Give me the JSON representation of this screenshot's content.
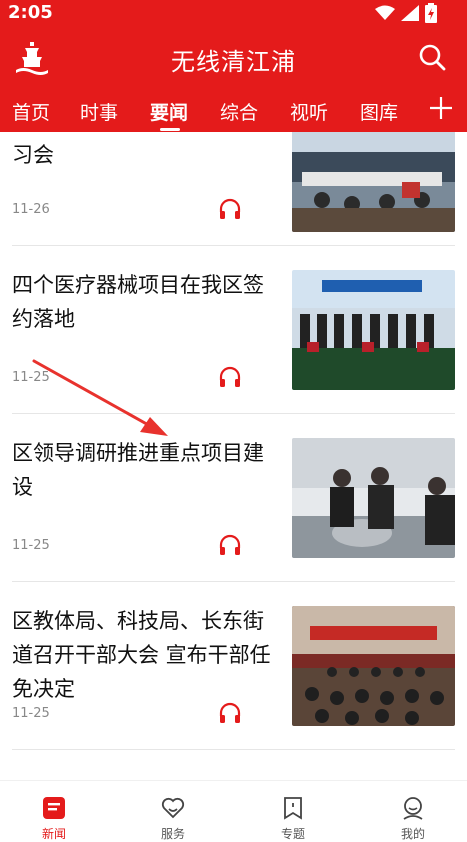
{
  "status_bar": {
    "time": "2:05"
  },
  "app": {
    "title": "无线清江浦"
  },
  "tabs": [
    {
      "label": "首页"
    },
    {
      "label": "时事"
    },
    {
      "label": "要闻"
    },
    {
      "label": "综合"
    },
    {
      "label": "视听"
    },
    {
      "label": "图库"
    }
  ],
  "active_tab": "要闻",
  "articles": [
    {
      "title": "习会",
      "date": "11-26"
    },
    {
      "title": "四个医疗器械项目在我区签约落地",
      "date": "11-25"
    },
    {
      "title": "区领导调研推进重点项目建设",
      "date": "11-25"
    },
    {
      "title": "区教体局、科技局、长东街道召开干部大会 宣布干部任免决定",
      "date": "11-25"
    }
  ],
  "bottom_nav": [
    {
      "label": "新闻",
      "icon": "news-icon"
    },
    {
      "label": "服务",
      "icon": "heart-icon"
    },
    {
      "label": "专题",
      "icon": "bookmark-icon"
    },
    {
      "label": "我的",
      "icon": "user-icon"
    }
  ],
  "colors": {
    "brand": "#e41b1b",
    "text": "#111111",
    "muted": "#888888"
  }
}
